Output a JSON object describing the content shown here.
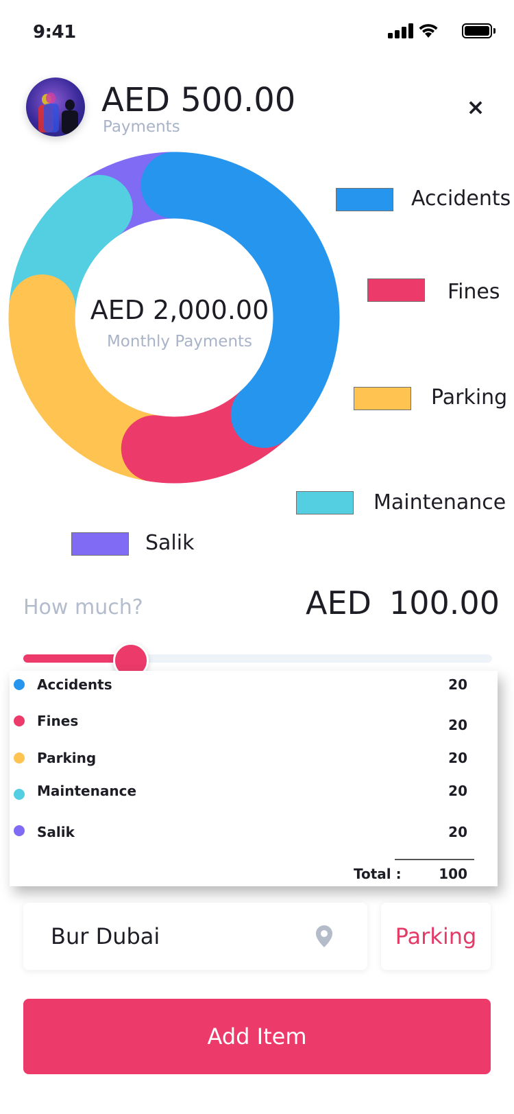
{
  "status_bar": {
    "time": "9:41"
  },
  "header": {
    "amount": "AED 500.00",
    "subtitle": "Payments",
    "close_symbol": "×",
    "avatar": "avatar-people-photo"
  },
  "chart_data": {
    "type": "pie",
    "center_title": "AED 2,000.00",
    "center_subtitle": "Monthly Payments",
    "categories": [
      "Accidents",
      "Fines",
      "Parking",
      "Maintenance",
      "Salik"
    ],
    "values": [
      400,
      150,
      250,
      150,
      100
    ],
    "colors": [
      "#2695ee",
      "#ec3a6a",
      "#fec351",
      "#54cfe2",
      "#806bf4"
    ],
    "track_color": "#eef3fa",
    "legend_placement": "right"
  },
  "amount_entry": {
    "prompt": "How much?",
    "currency": "AED",
    "value": "100.00",
    "slider_fraction": 0.23
  },
  "breakdown": {
    "rows": [
      {
        "label": "Accidents",
        "value": "20",
        "color": "#2695ee"
      },
      {
        "label": "Fines",
        "value": "20",
        "color": "#ec3a6a"
      },
      {
        "label": "Parking",
        "value": "20",
        "color": "#fec351"
      },
      {
        "label": "Maintenance",
        "value": "20",
        "color": "#54cfe2"
      },
      {
        "label": "Salik",
        "value": "20",
        "color": "#806bf4"
      }
    ],
    "total_label": "Total :",
    "total_value": "100"
  },
  "location": {
    "value": "Bur Dubai",
    "icon": "location-pin-icon"
  },
  "category_chip": {
    "label": "Parking"
  },
  "primary_action": {
    "label": "Add Item"
  },
  "accent_color": "#ec3a6a"
}
